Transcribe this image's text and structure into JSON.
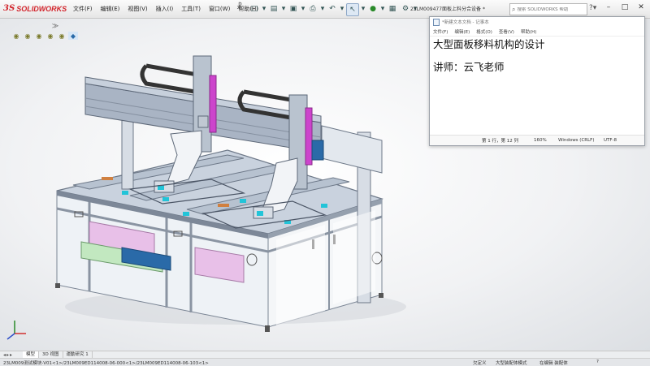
{
  "app": {
    "logo_ds": "3S",
    "logo_text": "SOLIDWORKS",
    "menu": [
      "文件(F)",
      "编辑(E)",
      "视图(V)",
      "插入(I)",
      "工具(T)",
      "窗口(W)",
      "帮助(H)"
    ],
    "doc_title": "23LM009477面板上料分合设备 *",
    "search_placeholder": "搜索 SOLIDWORKS 帮助"
  },
  "icons": {
    "logo": "ds-logo-icon",
    "pin": "pin-icon",
    "new": "new-document-icon",
    "open": "open-folder-icon",
    "save": "save-icon",
    "print": "print-icon",
    "undo": "undo-icon",
    "select": "select-cursor-icon",
    "rebuild": "traffic-light-icon",
    "options": "gear-icon",
    "search": "search-icon",
    "help": "question-icon",
    "minimize": "minimize-icon",
    "maximize": "maximize-icon",
    "close": "close-icon"
  },
  "colors": {
    "brand_red": "#d2232a",
    "frame_blue_gray": "#a9b4c4",
    "magenta_part": "#cc44cc",
    "cyan_part": "#22c4d8",
    "glass": "#dfe9f1"
  },
  "notepad": {
    "title": "*新建文本文档 - 记事本",
    "menu": [
      "文件(F)",
      "编辑(E)",
      "格式(O)",
      "查看(V)",
      "帮助(H)"
    ],
    "line1": "大型面板移料机构的设计",
    "line2": "讲师：云飞老师",
    "status": {
      "position": "第 1 行，第 12 列",
      "zoom": "160%",
      "eol": "Windows (CRLF)",
      "encoding": "UTF-8"
    }
  },
  "tabs": {
    "items": [
      "模型",
      "3D 视图",
      "運動研究 1"
    ]
  },
  "statusbar": {
    "path": "23LM009测试模块-V01<1>/23LM009ED114008-06-000<1>/23LM009ED114008-06-103<1>",
    "right1": "欠定义",
    "right2": "大型装配体模式",
    "right3": "在编辑 装配体",
    "right4": "?"
  }
}
